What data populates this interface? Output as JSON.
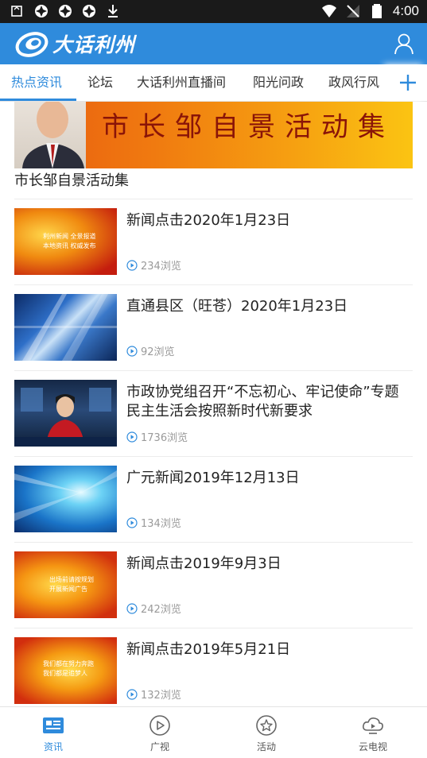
{
  "status_bar": {
    "time": "4:00"
  },
  "app": {
    "title": "大话利州"
  },
  "tabs": [
    {
      "label": "热点资讯",
      "active": true
    },
    {
      "label": "论坛"
    },
    {
      "label": "大话利州直播间"
    },
    {
      "label": "阳光问政"
    },
    {
      "label": "政风行风"
    }
  ],
  "banner": {
    "image_text": "市长邹自景活动集",
    "caption": "市长邹自景活动集"
  },
  "news": [
    {
      "title": "新闻点击2020年1月23日",
      "views": "234浏览",
      "thumb_text": [
        "利州新闻  全景报道",
        "本地资讯  权威发布"
      ]
    },
    {
      "title": "直通县区（旺苍）2020年1月23日",
      "views": "92浏览"
    },
    {
      "title": "市政协党组召开“不忘初心、牢记使命”专题民主生活会按照新时代新要求",
      "views": "1736浏览"
    },
    {
      "title": "广元新闻2019年12月13日",
      "views": "134浏览"
    },
    {
      "title": "新闻点击2019年9月3日",
      "views": "242浏览",
      "thumb_text": [
        "出场前请按规划",
        "开展新闻广告"
      ]
    },
    {
      "title": "新闻点击2019年5月21日",
      "views": "132浏览",
      "thumb_text": [
        "我们都在努力奔跑",
        "我们都是追梦人"
      ]
    }
  ],
  "bottom_nav": [
    {
      "label": "资讯",
      "icon": "news-icon",
      "active": true
    },
    {
      "label": "广视",
      "icon": "play-icon"
    },
    {
      "label": "活动",
      "icon": "star-icon"
    },
    {
      "label": "云电视",
      "icon": "cloud-tv-icon"
    }
  ],
  "colors": {
    "primary": "#2f8bdc",
    "status_bar": "#1a1a1a"
  }
}
